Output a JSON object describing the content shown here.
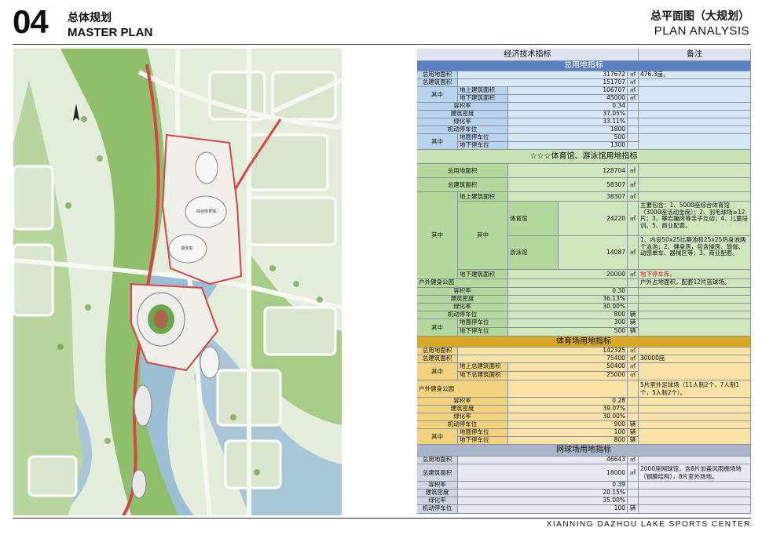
{
  "header": {
    "number": "04",
    "title_cn": "总体规划",
    "title_en": "MASTER PLAN",
    "right_cn": "总平面图（大规划）",
    "right_en": "PLAN ANALYSIS"
  },
  "map": {
    "labels": {
      "arena": "综合体育馆",
      "natatorium": "游泳馆"
    }
  },
  "table": {
    "top_header": {
      "left": "经济技术指标",
      "right": "备注"
    },
    "s1": {
      "title": "总用地指标",
      "r1": {
        "label": "总用地面积",
        "value": "317672",
        "unit": "㎡",
        "note": "476.3亩。"
      },
      "r2": {
        "label": "总建筑面积",
        "value": "151707",
        "unit": "㎡"
      },
      "r3": {
        "group": "其中",
        "sub": "地上建筑面积",
        "value": "106707",
        "unit": "㎡"
      },
      "r4": {
        "sub": "地下建筑面积",
        "value": "45000",
        "unit": "㎡"
      },
      "r5": {
        "label": "容积率",
        "value": "0.34"
      },
      "r6": {
        "label": "建筑密度",
        "value": "37.05%"
      },
      "r7": {
        "label": "绿化率",
        "value": "33.11%"
      },
      "r8": {
        "label": "机动停车位",
        "value": "1800"
      },
      "r9": {
        "group": "其中",
        "sub": "地面停车位",
        "value": "500"
      },
      "r10": {
        "sub": "地下停车位",
        "value": "1300"
      }
    },
    "s2": {
      "title": "☆☆☆体育馆、游泳馆用地指标",
      "r1": {
        "label": "总用地面积",
        "value": "128704",
        "unit": "㎡"
      },
      "r2": {
        "label": "总建筑面积",
        "value": "58307",
        "unit": "㎡"
      },
      "r3": {
        "sub": "地上建筑面积",
        "value": "38307",
        "unit": "㎡"
      },
      "group1": "其中",
      "group2": "其中",
      "r4": {
        "sub": "体育馆",
        "value": "24220",
        "unit": "㎡",
        "note": "主要包含：1、5000座综合体育馆（3000座活动坐席）；2、羽毛球场≥12片；3、攀岩蹦床等亲子互动；4、儿童培训。5、商业配套。"
      },
      "r5": {
        "sub": "游泳馆",
        "value": "14087",
        "unit": "㎡",
        "note": "1、内设50x25比赛池和25x25热身池两个泳池；2、健身房，包含操房、瑜伽、动感单车、器械区等；3、商业配套。"
      },
      "r6": {
        "sub": "地下建筑面积",
        "value": "20000",
        "unit": "㎡",
        "note": "地下停车库。"
      },
      "r7": {
        "label": "户外健身公园",
        "note": "户外占地面积，配套12片篮球场。"
      },
      "r8": {
        "label": "容积率",
        "value": "0.30"
      },
      "r9": {
        "label": "建筑密度",
        "value": "36.13%"
      },
      "r10": {
        "label": "绿化率",
        "value": "30.00%"
      },
      "r11": {
        "label": "机动停车位",
        "value": "800",
        "unit": "辆"
      },
      "r12": {
        "group": "其中",
        "sub": "地面停车位",
        "value": "300",
        "unit": "辆"
      },
      "r13": {
        "sub": "地下停车位",
        "value": "500",
        "unit": "辆"
      }
    },
    "s3": {
      "title": "体育场用地指标",
      "r1": {
        "label": "总用地面积",
        "value": "142325",
        "unit": "㎡"
      },
      "r2": {
        "label": "总建筑面积",
        "value": "75400",
        "unit": "㎡",
        "note": "30000座"
      },
      "r3": {
        "group": "其中",
        "sub": "地上总建筑面积",
        "value": "50400",
        "unit": "㎡"
      },
      "r4": {
        "sub": "地下总建筑面积",
        "value": "25000",
        "unit": "㎡"
      },
      "r5": {
        "label": "户外健身公园",
        "note": "5片室外足球场（11人制2个，7人制1个，5人制2个）。"
      },
      "r6": {
        "label": "容积率",
        "value": "0.28"
      },
      "r7": {
        "label": "建筑密度",
        "value": "39.07%"
      },
      "r8": {
        "label": "绿化率",
        "value": "30.00%"
      },
      "r9": {
        "label": "机动停车位",
        "value": "900",
        "unit": "辆"
      },
      "r10": {
        "group": "其中",
        "sub": "地面停车位",
        "value": "100",
        "unit": "辆"
      },
      "r11": {
        "sub": "地下停车位",
        "value": "800",
        "unit": "辆"
      }
    },
    "s4": {
      "title": "网球场用地指标",
      "r1": {
        "label": "总用地面积",
        "value": "46643",
        "unit": "㎡"
      },
      "r2": {
        "label": "总建筑面积",
        "value": "18000",
        "unit": "㎡",
        "note": "2000座网球馆，含8片加盖风雨棚场地（钢膜结构），8片室外场地。"
      },
      "r3": {
        "label": "容积率",
        "value": "0.39"
      },
      "r4": {
        "label": "建筑密度",
        "value": "20.15%"
      },
      "r5": {
        "label": "绿化率",
        "value": "35.00%"
      },
      "r6": {
        "label": "机动停车位",
        "value": "100",
        "unit": "辆"
      }
    }
  },
  "footer": "XIANNING DAZHOU LAKE SPORTS CENTER"
}
